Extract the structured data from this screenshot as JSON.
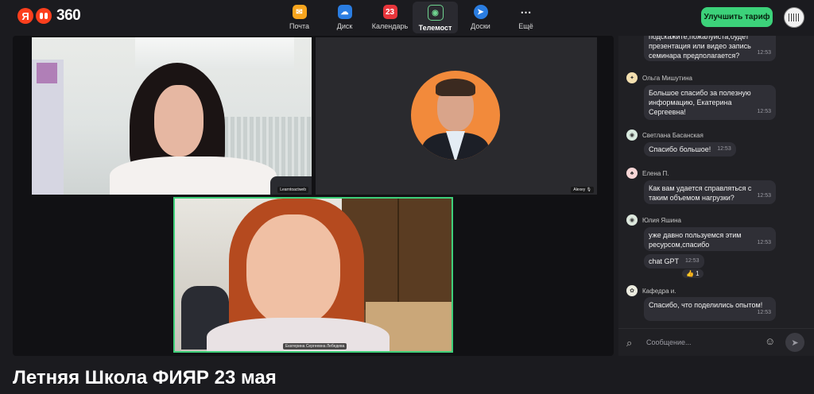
{
  "brand": {
    "ya": "Я",
    "name": "360"
  },
  "apps": [
    {
      "label": "Почта",
      "color": "#f7a51e",
      "glyph": "✉"
    },
    {
      "label": "Диск",
      "color": "#2a7de1",
      "glyph": "☁"
    },
    {
      "label": "Календарь",
      "color": "#e8353b",
      "glyph": "23"
    },
    {
      "label": "Телемост",
      "color": "#2a2a30",
      "glyph": "◉"
    },
    {
      "label": "Доски",
      "color": "#2a7de1",
      "glyph": "➤"
    },
    {
      "label": "Ещё",
      "color": "transparent",
      "glyph": "⋯"
    }
  ],
  "upgrade_label": "Улучшить тариф",
  "participants": [
    {
      "name": "Learntoactweb"
    },
    {
      "name": "Alexey"
    },
    {
      "name": "Екатерина Сергеевна Лебедева"
    }
  ],
  "chat": {
    "messages": [
      {
        "text": "подскажите,пожалуйста,будет презентация или видео запись семинара предполагается?",
        "time": "12:53"
      },
      {
        "author": "Ольга Мишутина",
        "text": "Большое спасибо за полезную информацию, Екатерина Сергеевна!",
        "time": "12:53"
      },
      {
        "author": "Светлана Басанская",
        "text": "Спасибо большое!",
        "time": "12:53"
      },
      {
        "author": "Елена П.",
        "text": "Как вам удается справляться с таким объемом нагрузки?",
        "time": "12:53"
      },
      {
        "author": "Юлия Яшина",
        "text": "уже давно пользуемся этим ресурсом,спасибо",
        "time": "12:53"
      },
      {
        "text": "chat GPT",
        "time": "12:53",
        "reaction": "👍 1"
      },
      {
        "author": "Кафедра и.",
        "text": "Спасибо, что поделились опытом!",
        "time": "12:53"
      }
    ],
    "placeholder": "Сообщение..."
  },
  "page_title": "Летняя Школа ФИЯР 23 мая"
}
